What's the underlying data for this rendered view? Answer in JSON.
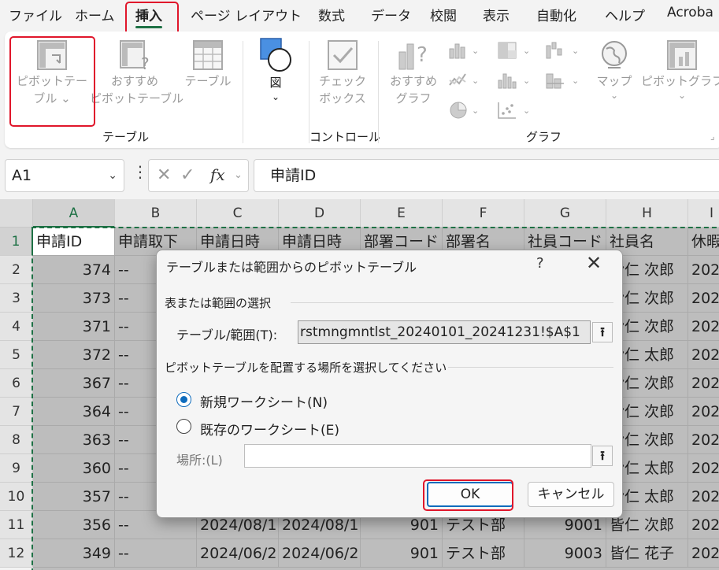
{
  "menu": {
    "tabs": [
      "ファイル",
      "ホーム",
      "挿入",
      "ページ レイアウト",
      "数式",
      "データ",
      "校閲",
      "表示",
      "自動化",
      "ヘルプ",
      "Acroba"
    ],
    "active": "挿入"
  },
  "ribbon": {
    "pivot_table": [
      "ピボットテー",
      "ブル ⌄"
    ],
    "recommended_pivot": [
      "おすすめ",
      "ピボットテーブル"
    ],
    "table": "テーブル",
    "illustrations": [
      "図",
      "⌄"
    ],
    "checkbox": [
      "チェック",
      "ボックス"
    ],
    "recommended_charts": [
      "おすすめ",
      "グラフ"
    ],
    "map": [
      "マップ",
      "⌄"
    ],
    "pivot_chart": [
      "ピボットグラフ",
      "⌄"
    ],
    "groups": {
      "table": "テーブル",
      "control": "コントロール",
      "chart": "グラフ"
    }
  },
  "formula_bar": {
    "name_box": "A1",
    "fx": "fx",
    "content": "申請ID"
  },
  "sheet": {
    "columns": [
      "A",
      "B",
      "C",
      "D",
      "E",
      "F",
      "G",
      "H",
      "I"
    ],
    "rows": [
      "1",
      "2",
      "3",
      "4",
      "5",
      "6",
      "7",
      "8",
      "9",
      "10",
      "11",
      "12"
    ],
    "header": [
      "申請ID",
      "申請取下",
      "申請日時",
      "申請日時",
      "部署コード",
      "部署名",
      "社員コード",
      "社員名",
      "休暇"
    ],
    "data": [
      [
        "374",
        "--",
        "",
        "",
        "",
        "",
        "",
        "皆仁 次郎",
        "202"
      ],
      [
        "373",
        "--",
        "",
        "",
        "",
        "",
        "",
        "皆仁 次郎",
        "202"
      ],
      [
        "371",
        "--",
        "",
        "",
        "",
        "",
        "",
        "皆仁 次郎",
        "202"
      ],
      [
        "372",
        "--",
        "",
        "",
        "",
        "",
        "",
        "皆仁 太郎",
        "202"
      ],
      [
        "367",
        "--",
        "",
        "",
        "",
        "",
        "",
        "皆仁 次郎",
        "202"
      ],
      [
        "364",
        "--",
        "",
        "",
        "",
        "",
        "",
        "皆仁 次郎",
        "202"
      ],
      [
        "363",
        "--",
        "",
        "",
        "",
        "",
        "",
        "皆仁 次郎",
        "202"
      ],
      [
        "360",
        "--",
        "",
        "",
        "",
        "",
        "",
        "皆仁 太郎",
        "202"
      ],
      [
        "357",
        "--",
        "",
        "",
        "",
        "",
        "",
        "皆仁 太郎",
        "202"
      ],
      [
        "356",
        "--",
        "2024/08/1",
        "2024/08/1",
        "901",
        "テスト部",
        "9001",
        "皆仁 次郎",
        "202"
      ],
      [
        "349",
        "--",
        "2024/06/2",
        "2024/06/2",
        "901",
        "テスト部",
        "9003",
        "皆仁 花子",
        "202"
      ]
    ]
  },
  "dialog": {
    "title": "テーブルまたは範囲からのピボットテーブル",
    "help": "?",
    "close": "✕",
    "section1": "表または範囲の選択",
    "range_label": "テーブル/範囲(T):",
    "range_value": "rstmngmntlst_20240101_20241231!$A$1",
    "section2": "ピボットテーブルを配置する場所を選択してください",
    "radio_new": "新規ワークシート(N)",
    "radio_existing": "既存のワークシート(E)",
    "location_label": "場所:(L)",
    "location_value": "",
    "ok": "OK",
    "cancel": "キャンセル"
  },
  "colors": {
    "accent": "#1e7145",
    "highlight": "#e0162b",
    "dialog_primary": "#0f6cbd"
  }
}
